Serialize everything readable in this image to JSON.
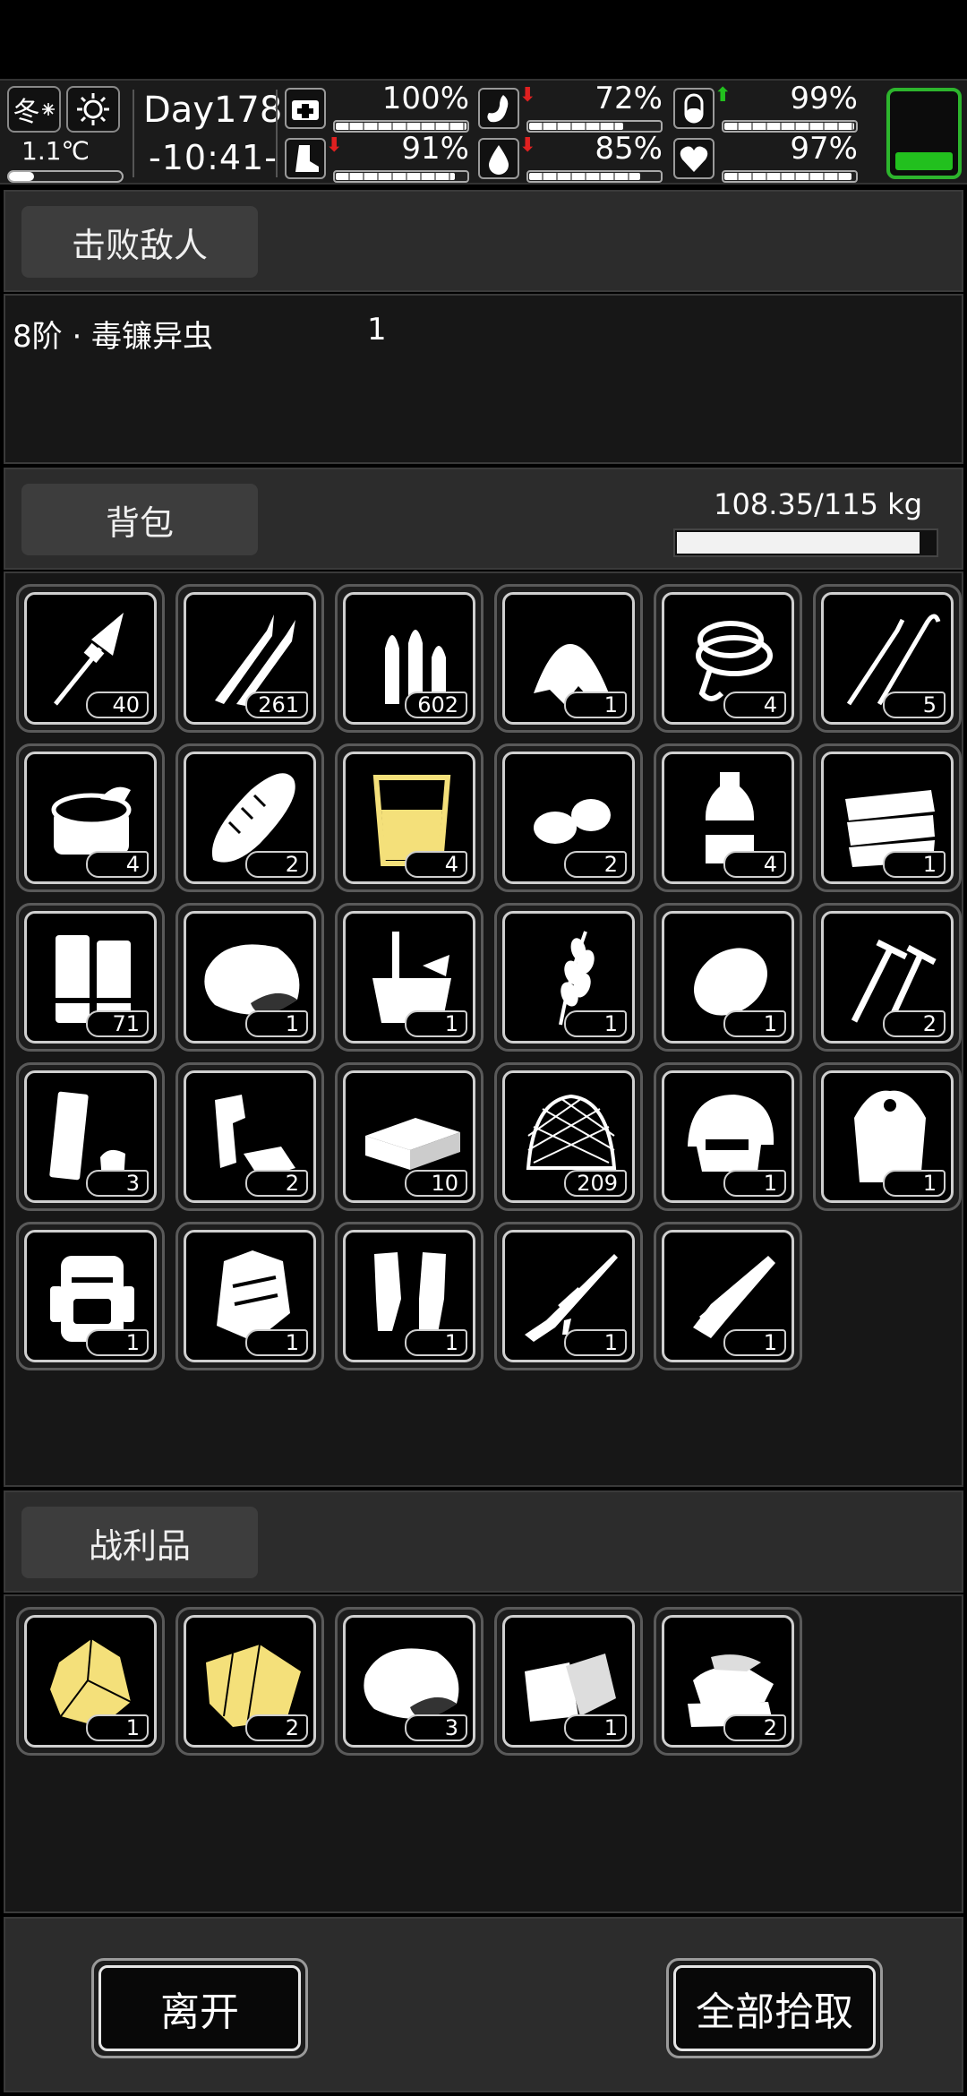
{
  "status": {
    "season": "冬",
    "temperature": "1.1℃",
    "temperature_level": 0.22,
    "day": "Day178",
    "time": "-10:41-",
    "battery_level": 0.28,
    "stats": [
      {
        "name": "health",
        "icon": "medkit-icon",
        "value": "100%",
        "level": 1.0,
        "arrow": ""
      },
      {
        "name": "hunger",
        "icon": "stomach-icon",
        "value": "72%",
        "level": 0.72,
        "arrow": "down"
      },
      {
        "name": "mood",
        "icon": "pill-icon",
        "value": "99%",
        "level": 0.99,
        "arrow": "up"
      },
      {
        "name": "stamina",
        "icon": "boot-icon",
        "value": "91%",
        "level": 0.91,
        "arrow": "down"
      },
      {
        "name": "thirst",
        "icon": "water-drop-icon",
        "value": "85%",
        "level": 0.85,
        "arrow": "down"
      },
      {
        "name": "spirit",
        "icon": "heart-icon",
        "value": "97%",
        "level": 0.97,
        "arrow": ""
      }
    ]
  },
  "defeated": {
    "tab_label": "击败敌人",
    "enemy_name": "8阶 · 毒镰异虫",
    "enemy_count": "1"
  },
  "backpack": {
    "tab_label": "背包",
    "weight_text": "108.35/115 kg",
    "weight_level": 0.942,
    "items": [
      {
        "icon": "rocket-ammo-icon",
        "count": "40"
      },
      {
        "icon": "rifle-rounds-icon",
        "count": "261"
      },
      {
        "icon": "bullets-icon",
        "count": "602"
      },
      {
        "icon": "cloth-scrap-icon",
        "count": "1"
      },
      {
        "icon": "rope-hook-icon",
        "count": "4"
      },
      {
        "icon": "lockpick-icon",
        "count": "5"
      },
      {
        "icon": "canned-food-icon",
        "count": "4"
      },
      {
        "icon": "bread-icon",
        "count": "2"
      },
      {
        "icon": "juice-cup-icon",
        "count": "4"
      },
      {
        "icon": "nuts-icon",
        "count": "2"
      },
      {
        "icon": "water-bottle-icon",
        "count": "4"
      },
      {
        "icon": "fabric-stack-icon",
        "count": "1"
      },
      {
        "icon": "shotgun-shells-icon",
        "count": "71"
      },
      {
        "icon": "raw-meat-icon",
        "count": "1"
      },
      {
        "icon": "mortar-bucket-icon",
        "count": "1"
      },
      {
        "icon": "wheat-icon",
        "count": "1"
      },
      {
        "icon": "potato-icon",
        "count": "1"
      },
      {
        "icon": "screws-icon",
        "count": "2"
      },
      {
        "icon": "shell-casing-icon",
        "count": "3"
      },
      {
        "icon": "scrap-parts-icon",
        "count": "2"
      },
      {
        "icon": "ammo-box-icon",
        "count": "10"
      },
      {
        "icon": "net-icon",
        "count": "209"
      },
      {
        "icon": "tactical-helmet-icon",
        "count": "1"
      },
      {
        "icon": "fur-cloak-icon",
        "count": "1"
      },
      {
        "icon": "large-backpack-icon",
        "count": "1"
      },
      {
        "icon": "tactical-vest-icon",
        "count": "1"
      },
      {
        "icon": "knee-pads-icon",
        "count": "1"
      },
      {
        "icon": "sniper-rifle-icon",
        "count": "1"
      },
      {
        "icon": "minigun-icon",
        "count": "1"
      }
    ]
  },
  "loot": {
    "tab_label": "战利品",
    "items": [
      {
        "icon": "gold-ore-icon",
        "count": "1"
      },
      {
        "icon": "yellow-cloth-icon",
        "count": "2"
      },
      {
        "icon": "raw-meat-icon",
        "count": "3"
      },
      {
        "icon": "white-cloth-icon",
        "count": "1"
      },
      {
        "icon": "fabric-pile-icon",
        "count": "2"
      }
    ]
  },
  "footer": {
    "leave_label": "离开",
    "pickup_all_label": "全部拾取"
  }
}
